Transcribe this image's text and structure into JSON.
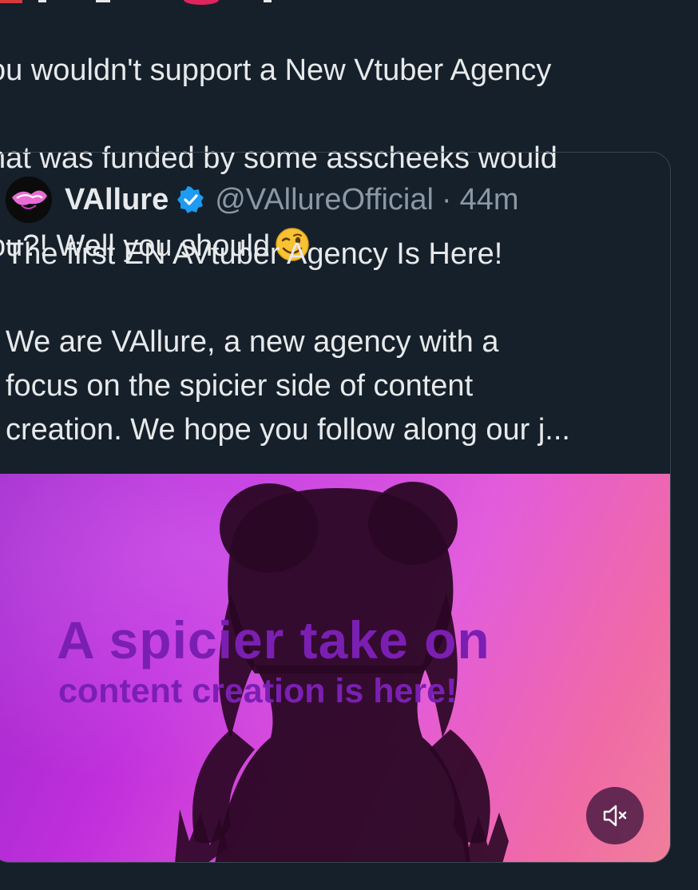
{
  "tweet": {
    "lines": [
      "ou wouldn't support a New Vtuber Agency",
      "hat was funded by some asscheeks would",
      "ou?! Well you should"
    ],
    "emoji": "winking-face"
  },
  "quote": {
    "display_name": "VAllure",
    "verified": true,
    "handle": "@VAllureOfficial",
    "separator": "·",
    "timestamp": "44m",
    "body": {
      "paragraph1": "The first EN AVtuber Agency Is Here!",
      "paragraph2_lines": [
        "We are VAllure, a new agency with a",
        "focus on the spicier side of content",
        "creation. We hope you follow along our j..."
      ]
    },
    "media": {
      "headline": "A spicier take on",
      "subline": "content creation is here!",
      "muted": true
    }
  },
  "colors": {
    "background": "#15202b",
    "text": "#e7e9ea",
    "secondary_text": "#8b98a5",
    "verified_blue": "#1d9bf0",
    "media_text": "#7b1fb3"
  }
}
